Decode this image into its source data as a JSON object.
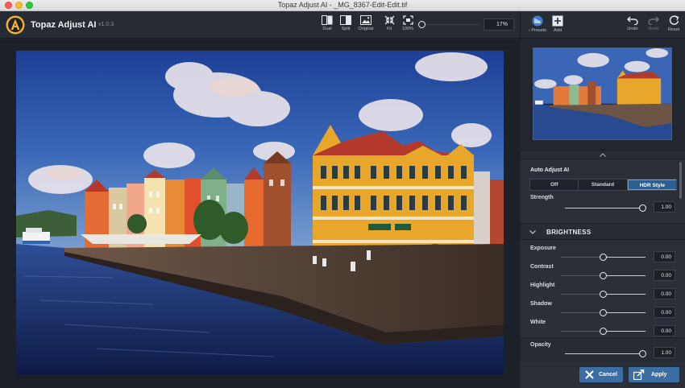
{
  "window": {
    "title": "Topaz Adjust AI - _MG_8367-Edit-Edit.tif"
  },
  "app": {
    "name": "Topaz Adjust AI",
    "version": "v1.0.3"
  },
  "toolbar": {
    "view_buttons": [
      "Dual",
      "Split",
      "Original"
    ],
    "fit_label": "Fit",
    "actual_label": "100%",
    "zoom_value": "17%",
    "presets_label": "Presets",
    "add_label": "Add",
    "undo_label": "Undo",
    "redo_label": "Redo",
    "reset_label": "Reset"
  },
  "panel": {
    "auto_adjust": {
      "title": "Auto Adjust AI",
      "modes": [
        "Off",
        "Standard",
        "HDR Style"
      ],
      "selected": "HDR Style",
      "strength_label": "Strength",
      "strength_value": "1.00",
      "strength_fraction": 0.96
    },
    "brightness": {
      "title": "BRIGHTNESS",
      "sliders": [
        {
          "label": "Exposure",
          "value": "0.00",
          "fraction": 0.5
        },
        {
          "label": "Contrast",
          "value": "0.00",
          "fraction": 0.5
        },
        {
          "label": "Highlight",
          "value": "0.00",
          "fraction": 0.5
        },
        {
          "label": "Shadow",
          "value": "0.00",
          "fraction": 0.5
        },
        {
          "label": "White",
          "value": "0.00",
          "fraction": 0.5
        }
      ]
    },
    "opacity": {
      "label": "Opacity",
      "value": "1.00",
      "fraction": 0.96
    },
    "cancel_label": "Cancel",
    "apply_label": "Apply"
  },
  "colors": {
    "accent": "#3c6ea3",
    "panel": "#2a2f38",
    "toolbar": "#262b34",
    "canvas": "#1c2028"
  }
}
